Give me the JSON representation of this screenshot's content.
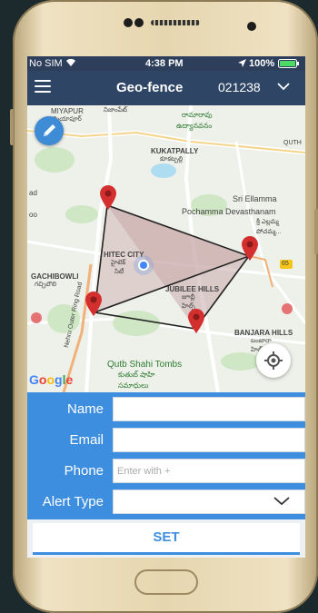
{
  "status": {
    "carrier": "No SIM",
    "time": "4:38 PM",
    "battery": "100%"
  },
  "nav": {
    "title": "Geo-fence",
    "id": "021238"
  },
  "map": {
    "labels": [
      "MIYAPUR",
      "మియాపూర్",
      "నిజాంపేట్",
      "రామారావు",
      "ఉద్యానవనం",
      "KUKATPALLY",
      "కూకట్పల్లి",
      "QUTH",
      "Sri Ellamma",
      "Pochamma Devasthanam",
      "శ్రీ ఎల్లమ్మ",
      "పోచమ్మ...",
      "HITEC CITY",
      "హైటెక్",
      "సిటీ",
      "GACHIBOWLI",
      "గచ్చిబౌలి",
      "JUBILEE HILLS",
      "జూబ్లీ",
      "హిల్స్",
      "BANJARA HILLS",
      "బంజారా",
      "హిల్స్",
      "Qutb Shahi Tombs",
      "కుతుబ్ షాహి",
      "సమాధులు",
      "Nehru Outer Ring Road",
      "65",
      "ad",
      "oo"
    ],
    "google": [
      "G",
      "o",
      "o",
      "g",
      "l",
      "e"
    ]
  },
  "form": {
    "name_label": "Name",
    "email_label": "Email",
    "phone_label": "Phone",
    "phone_placeholder": "Enter with +",
    "alert_label": "Alert Type",
    "name_value": "",
    "email_value": "",
    "alert_value": ""
  },
  "set_label": "SET",
  "colors": {
    "navbar": "#2e4566",
    "accent": "#3e8ee0",
    "pin": "#d32f2f"
  }
}
